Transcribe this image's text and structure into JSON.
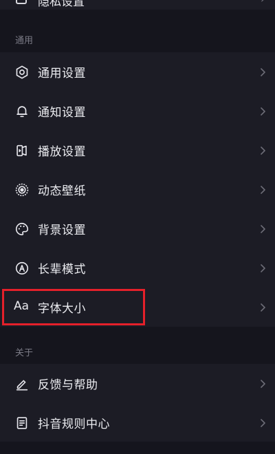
{
  "top_partial": {
    "label": "隐私设置"
  },
  "sections": [
    {
      "header": "通用",
      "items": [
        {
          "label": "通用设置",
          "icon": "gear-icon"
        },
        {
          "label": "通知设置",
          "icon": "bell-icon"
        },
        {
          "label": "播放设置",
          "icon": "play-settings-icon"
        },
        {
          "label": "动态壁纸",
          "icon": "dynamic-wallpaper-icon"
        },
        {
          "label": "背景设置",
          "icon": "palette-icon"
        },
        {
          "label": "长辈模式",
          "icon": "elder-mode-icon"
        },
        {
          "label": "字体大小",
          "icon": "font-size-icon",
          "icon_text": "Aa",
          "highlighted": true
        }
      ]
    },
    {
      "header": "关于",
      "items": [
        {
          "label": "反馈与帮助",
          "icon": "edit-pencil-icon"
        },
        {
          "label": "抖音规则中心",
          "icon": "rules-document-icon"
        }
      ]
    }
  ],
  "colors": {
    "background": "#15151d",
    "item_background": "#1c1c25",
    "text": "#ecedf1",
    "header_text": "#7b7b86",
    "chevron": "#6e6e78",
    "highlight": "#e5202a"
  }
}
